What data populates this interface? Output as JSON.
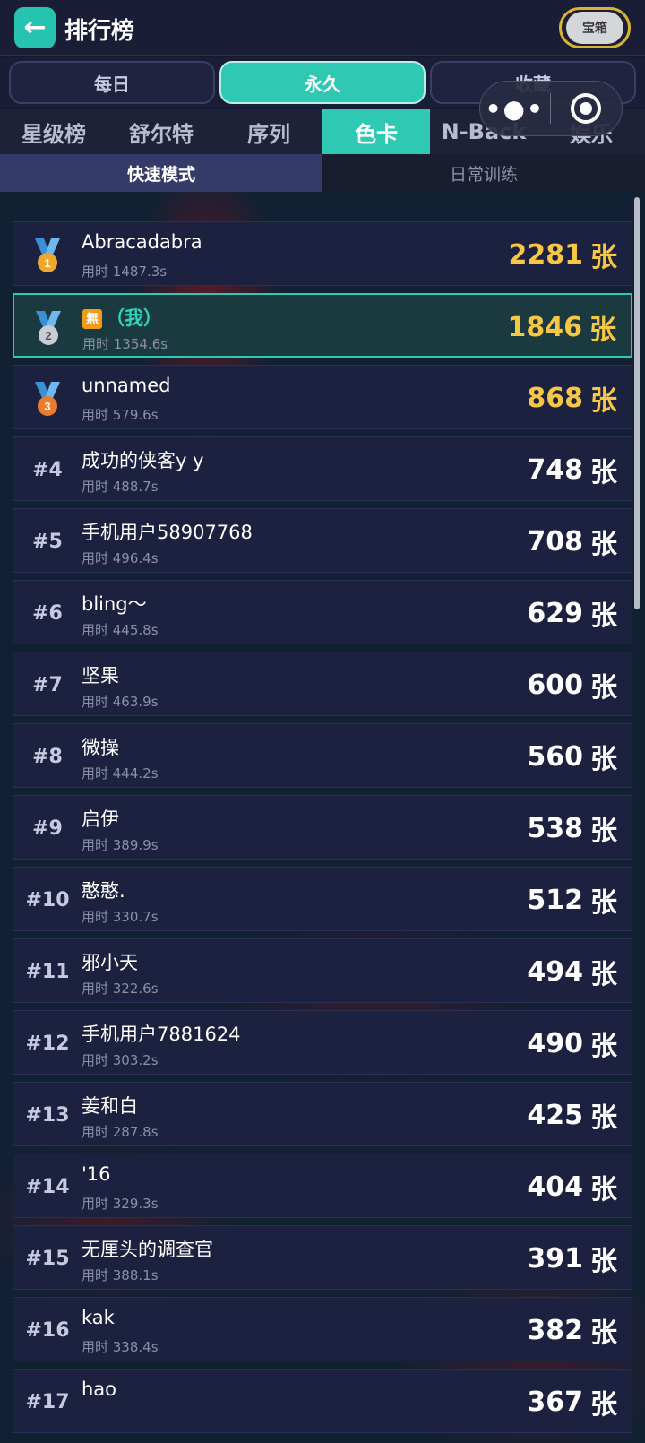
{
  "header": {
    "title": "排行榜",
    "chest_label": "宝箱"
  },
  "period_tabs": [
    {
      "label": "每日",
      "active": false
    },
    {
      "label": "永久",
      "active": true
    },
    {
      "label": "收藏",
      "active": false
    }
  ],
  "category_tabs": [
    {
      "label": "星级榜",
      "active": false
    },
    {
      "label": "舒尔特",
      "active": false
    },
    {
      "label": "序列",
      "active": false
    },
    {
      "label": "色卡",
      "active": true
    },
    {
      "label": "N-Back",
      "active": false
    },
    {
      "label": "娱乐",
      "active": false
    }
  ],
  "mode_tabs": [
    {
      "label": "快速模式",
      "active": true
    },
    {
      "label": "日常训练",
      "active": false
    }
  ],
  "capsule": {
    "more_icon": "more-dots-icon",
    "close_icon": "target-icon"
  },
  "colors": {
    "accent": "#2fc9b3",
    "gold": "#f6c744",
    "row_bg": "#1d2140"
  },
  "entries": [
    {
      "rank": "1",
      "name": "Abracadabra",
      "time": "用时 1487.3s",
      "score": "2281",
      "unit": "张",
      "medal": "gold"
    },
    {
      "rank": "2",
      "tag": "無",
      "name": "（我）",
      "time": "用时 1354.6s",
      "score": "1846",
      "unit": "张",
      "medal": "silver",
      "me": true
    },
    {
      "rank": "3",
      "name": "unnamed",
      "time": "用时 579.6s",
      "score": "868",
      "unit": "张",
      "medal": "bronze"
    },
    {
      "rank": "#4",
      "name": "成功的侠客y y",
      "time": "用时 488.7s",
      "score": "748",
      "unit": "张"
    },
    {
      "rank": "#5",
      "name": "手机用户58907768",
      "time": "用时 496.4s",
      "score": "708",
      "unit": "张"
    },
    {
      "rank": "#6",
      "name": "bling～",
      "time": "用时 445.8s",
      "score": "629",
      "unit": "张"
    },
    {
      "rank": "#7",
      "name": "坚果",
      "time": "用时 463.9s",
      "score": "600",
      "unit": "张"
    },
    {
      "rank": "#8",
      "name": "微操",
      "time": "用时 444.2s",
      "score": "560",
      "unit": "张"
    },
    {
      "rank": "#9",
      "name": "启伊",
      "time": "用时 389.9s",
      "score": "538",
      "unit": "张"
    },
    {
      "rank": "#10",
      "name": "憨憨.",
      "time": "用时 330.7s",
      "score": "512",
      "unit": "张"
    },
    {
      "rank": "#11",
      "name": "邪小天",
      "time": "用时 322.6s",
      "score": "494",
      "unit": "张"
    },
    {
      "rank": "#12",
      "name": "手机用户7881624",
      "time": "用时 303.2s",
      "score": "490",
      "unit": "张"
    },
    {
      "rank": "#13",
      "name": "姜和白",
      "time": "用时 287.8s",
      "score": "425",
      "unit": "张"
    },
    {
      "rank": "#14",
      "name": "'16",
      "time": "用时 329.3s",
      "score": "404",
      "unit": "张"
    },
    {
      "rank": "#15",
      "name": "无厘头的调查官",
      "time": "用时 388.1s",
      "score": "391",
      "unit": "张"
    },
    {
      "rank": "#16",
      "name": "kak",
      "time": "用时 338.4s",
      "score": "382",
      "unit": "张"
    },
    {
      "rank": "#17",
      "name": "hao",
      "time": "",
      "score": "367",
      "unit": "张"
    }
  ]
}
